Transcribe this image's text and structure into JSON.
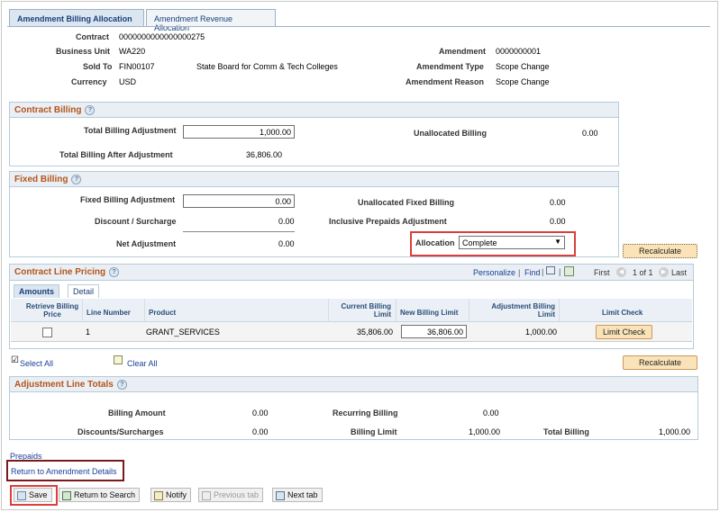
{
  "tabs": [
    "Amendment Billing Allocation",
    "Amendment Revenue Allocation"
  ],
  "header": {
    "contract_label": "Contract",
    "contract_value": "0000000000000000275",
    "bu_label": "Business Unit",
    "bu_value": "WA220",
    "soldto_label": "Sold To",
    "soldto_value": "FIN00107",
    "soldto_name": "State Board for Comm & Tech Colleges",
    "currency_label": "Currency",
    "currency_value": "USD",
    "amendment_label": "Amendment",
    "amendment_value": "0000000001",
    "amendtype_label": "Amendment Type",
    "amendtype_value": "Scope Change",
    "amendreason_label": "Amendment Reason",
    "amendreason_value": "Scope Change"
  },
  "contract_billing": {
    "title": "Contract Billing",
    "total_adj_label": "Total Billing Adjustment",
    "total_adj_value": "1,000.00",
    "unalloc_label": "Unallocated Billing",
    "unalloc_value": "0.00",
    "after_adj_label": "Total Billing After Adjustment",
    "after_adj_value": "36,806.00"
  },
  "fixed_billing": {
    "title": "Fixed Billing",
    "fixed_adj_label": "Fixed Billing Adjustment",
    "fixed_adj_value": "0.00",
    "unalloc_fixed_label": "Unallocated Fixed Billing",
    "unalloc_fixed_value": "0.00",
    "discount_label": "Discount / Surcharge",
    "discount_value": "0.00",
    "prepaids_label": "Inclusive Prepaids Adjustment",
    "prepaids_value": "0.00",
    "net_label": "Net Adjustment",
    "net_value": "0.00",
    "allocation_label": "Allocation",
    "allocation_value": "Complete",
    "recalc_label": "Recalculate"
  },
  "line_pricing": {
    "title": "Contract Line Pricing",
    "personalize": "Personalize",
    "find": "Find",
    "first": "First",
    "paging": "1 of 1",
    "last": "Last",
    "subtabs": [
      "Amounts",
      "Detail"
    ],
    "columns": [
      "Retrieve Billing Price",
      "Line Number",
      "Product",
      "Current Billing Limit",
      "New Billing Limit",
      "Adjustment Billing Limit",
      "Limit Check"
    ],
    "rows": [
      {
        "line": "1",
        "product": "GRANT_SERVICES",
        "current": "35,806.00",
        "new": "36,806.00",
        "adjust": "1,000.00",
        "check_label": "Limit Check"
      }
    ]
  },
  "select_all": "Select All",
  "clear_all": "Clear All",
  "recalc2_label": "Recalculate",
  "adjustment_totals": {
    "title": "Adjustment Line Totals",
    "billing_amount_label": "Billing Amount",
    "billing_amount_value": "0.00",
    "recurring_label": "Recurring Billing",
    "recurring_value": "0.00",
    "disc_label": "Discounts/Surcharges",
    "disc_value": "0.00",
    "limit_label": "Billing Limit",
    "limit_value": "1,000.00",
    "total_label": "Total Billing",
    "total_value": "1,000.00"
  },
  "links": {
    "prepaids": "Prepaids",
    "return": "Return to Amendment Details"
  },
  "toolbar": {
    "save": "Save",
    "return_search": "Return to Search",
    "notify": "Notify",
    "prev_tab": "Previous tab",
    "next_tab": "Next tab"
  },
  "colors": {
    "accent_orange": "#b5541a",
    "highlight_red": "#d8403c",
    "link_blue": "#1a3f9a"
  }
}
